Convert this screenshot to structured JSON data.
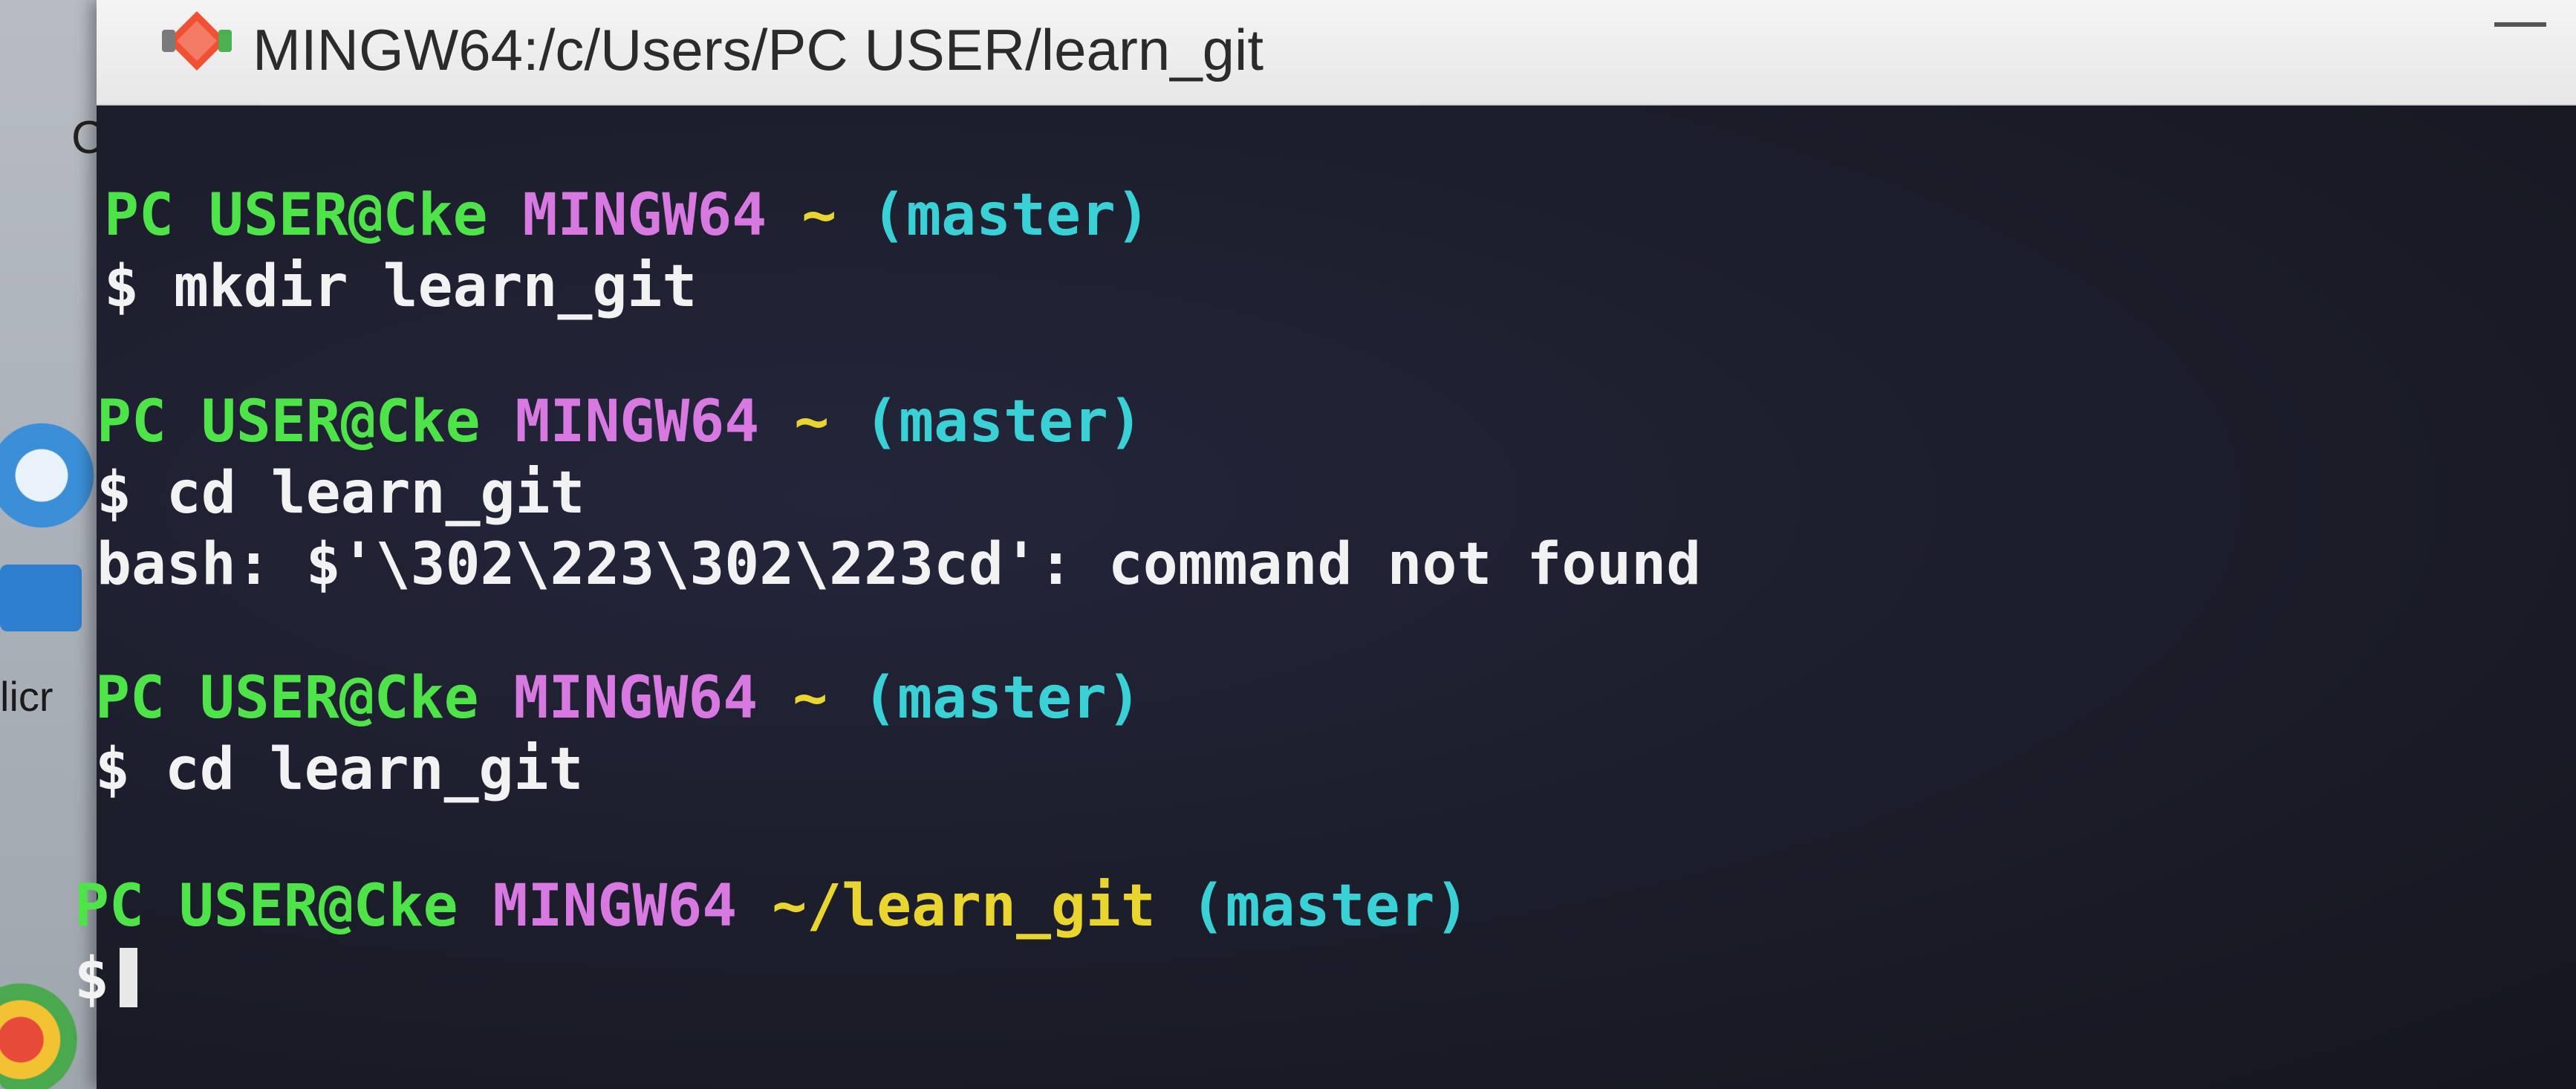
{
  "desktop": {
    "partial_label_top": "C",
    "partial_label_mid": "licr"
  },
  "window": {
    "title": "MINGW64:/c/Users/PC USER/learn_git"
  },
  "terminal": {
    "blocks": [
      {
        "user": "PC USER@Cke",
        "host": "MINGW64",
        "path": "~",
        "branch": "(master)",
        "command": "$ mkdir learn_git"
      },
      {
        "user": "PC USER@Cke",
        "host": "MINGW64",
        "path": "~",
        "branch": "(master)",
        "command": "$ cd learn_git",
        "output": "bash: $'\\302\\223\\302\\223cd': command not found"
      },
      {
        "user": "PC USER@Cke",
        "host": "MINGW64",
        "path": "~",
        "branch": "(master)",
        "command": "$ cd learn_git"
      },
      {
        "user": "PC USER@Cke",
        "host": "MINGW64",
        "path": "~/learn_git",
        "branch": "(master)",
        "command": "$"
      }
    ]
  },
  "colors": {
    "user": "#4fe34a",
    "host": "#d779e0",
    "path": "#e9d430",
    "branch": "#3ad1d6",
    "background": "#1e1f2c"
  },
  "icons": {
    "title": "git-bash-icon"
  }
}
